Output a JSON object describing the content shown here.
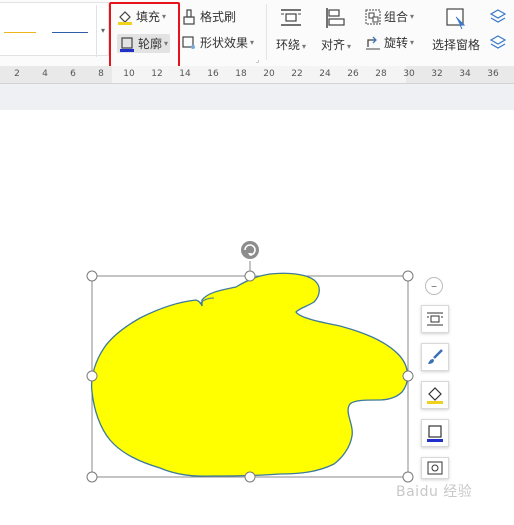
{
  "toolbar": {
    "fill_label": "填充",
    "outline_label": "轮廓",
    "format_painter_label": "格式刷",
    "shape_effects_label": "形状效果",
    "wrap_label": "环绕",
    "align_label": "对齐",
    "group_label": "组合",
    "rotate_label": "旋转",
    "selection_pane_label": "选择窗格",
    "line_colors": [
      "#f0b41e",
      "#2e5ea8"
    ],
    "highlight_color": "#e8121b"
  },
  "ruler": {
    "ticks": [
      "2",
      "4",
      "6",
      "8",
      "10",
      "12",
      "14",
      "16",
      "18",
      "20",
      "22",
      "24",
      "26",
      "28",
      "30",
      "32",
      "34",
      "36"
    ]
  },
  "shape": {
    "fill_color": "#ffff00",
    "outline_color": "#3e7a9a"
  },
  "side_panel": {
    "icons": [
      "wrap-text-icon",
      "brush-icon",
      "fill-icon",
      "outline-icon",
      "image-icon"
    ]
  },
  "watermark": "Baidu 经验"
}
